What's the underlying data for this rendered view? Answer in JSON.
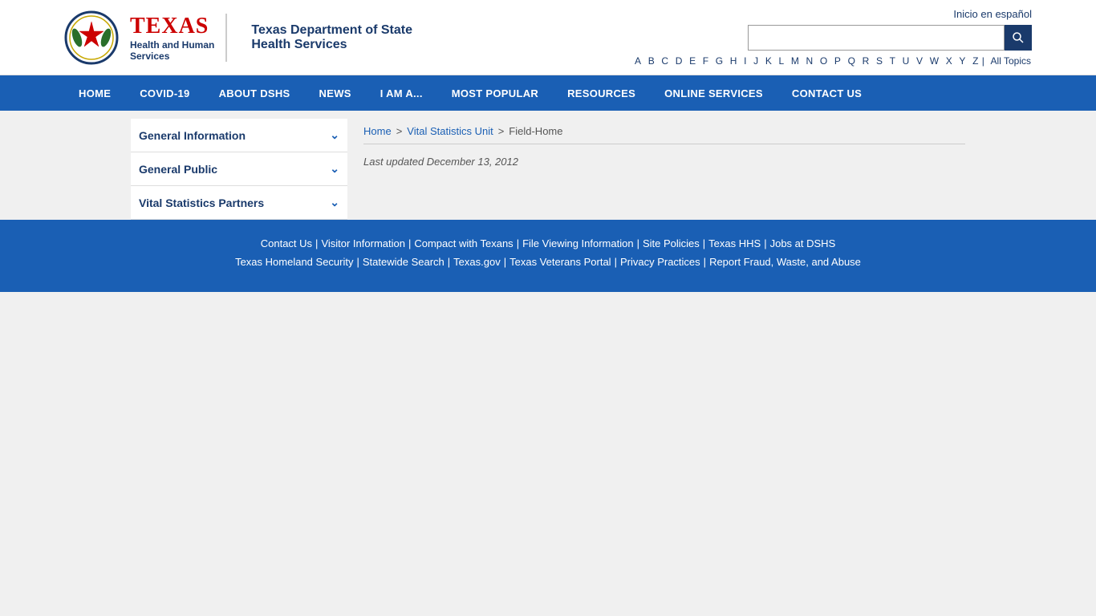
{
  "header": {
    "inicio_link": "Inicio en español",
    "logo_texas": "TEXAS",
    "logo_sub1": "Health and Human",
    "logo_sub2": "Services",
    "logo_dshs_line1": "Texas Department of State",
    "logo_dshs_line2": "Health Services",
    "search_placeholder": "",
    "search_button_label": "🔍"
  },
  "az_bar": {
    "letters": [
      "A",
      "B",
      "C",
      "D",
      "E",
      "F",
      "G",
      "H",
      "I",
      "J",
      "K",
      "L",
      "M",
      "N",
      "O",
      "P",
      "Q",
      "R",
      "S",
      "T",
      "U",
      "V",
      "W",
      "X",
      "Y",
      "Z"
    ],
    "all_topics": "All Topics"
  },
  "nav": {
    "items": [
      {
        "label": "HOME"
      },
      {
        "label": "COVID-19"
      },
      {
        "label": "ABOUT DSHS"
      },
      {
        "label": "NEWS"
      },
      {
        "label": "I AM A..."
      },
      {
        "label": "MOST POPULAR"
      },
      {
        "label": "RESOURCES"
      },
      {
        "label": "ONLINE SERVICES"
      },
      {
        "label": "CONTACT US"
      }
    ]
  },
  "sidebar": {
    "items": [
      {
        "label": "General Information"
      },
      {
        "label": "General Public"
      },
      {
        "label": "Vital Statistics Partners"
      }
    ]
  },
  "breadcrumb": {
    "home": "Home",
    "vital_statistics": "Vital Statistics Unit",
    "current": "Field-Home"
  },
  "main": {
    "last_updated_label": "Last updated  December 13, 2012"
  },
  "footer": {
    "row1": [
      {
        "label": "Contact Us"
      },
      {
        "label": "Visitor Information"
      },
      {
        "label": "Compact with Texans"
      },
      {
        "label": "File Viewing Information"
      },
      {
        "label": "Site Policies"
      },
      {
        "label": "Texas HHS"
      },
      {
        "label": "Jobs at DSHS"
      }
    ],
    "row2": [
      {
        "label": "Texas Homeland Security"
      },
      {
        "label": "Statewide Search"
      },
      {
        "label": "Texas.gov"
      },
      {
        "label": "Texas Veterans Portal"
      },
      {
        "label": "Privacy Practices"
      },
      {
        "label": "Report Fraud, Waste, and Abuse"
      }
    ]
  }
}
